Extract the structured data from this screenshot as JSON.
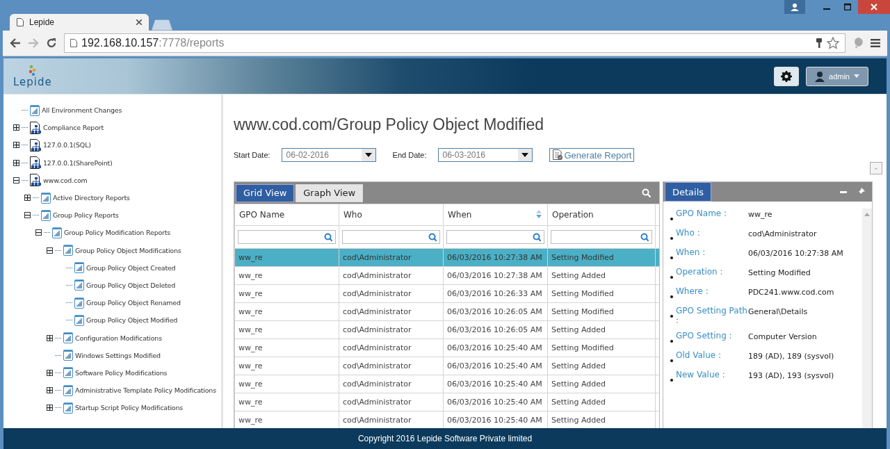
{
  "browser": {
    "tab_title": "Lepide",
    "url_host": "192.168.10.157",
    "url_rest": ":7778/reports"
  },
  "header": {
    "logo_text": "Lepide",
    "user": "admin"
  },
  "tree": [
    {
      "label": "All Environment Changes",
      "kind": "report"
    },
    {
      "label": "Compliance Report",
      "kind": "site",
      "expanded": false
    },
    {
      "label": "127.0.0.1(SQL)",
      "kind": "site",
      "expanded": false
    },
    {
      "label": "127.0.0.1(SharePoint)",
      "kind": "site",
      "expanded": false
    },
    {
      "label": "www.cod.com",
      "kind": "site",
      "expanded": true,
      "children": [
        {
          "label": "Active Directory Reports",
          "kind": "report",
          "expanded": false
        },
        {
          "label": "Group Policy Reports",
          "kind": "report",
          "expanded": true,
          "children": [
            {
              "label": "Group Policy Modification Reports",
              "kind": "report",
              "expanded": true,
              "children": [
                {
                  "label": "Group Policy Object Modifications",
                  "kind": "report",
                  "expanded": true,
                  "children": [
                    {
                      "label": "Group Policy Object Created",
                      "kind": "report"
                    },
                    {
                      "label": "Group Policy Object Deleted",
                      "kind": "report"
                    },
                    {
                      "label": "Group Policy Object Renamed",
                      "kind": "report"
                    },
                    {
                      "label": "Group Policy Object Modified",
                      "kind": "report"
                    }
                  ]
                },
                {
                  "label": "Configuration Modifications",
                  "kind": "report",
                  "expanded": false
                },
                {
                  "label": "Windows Settings Modified",
                  "kind": "report"
                },
                {
                  "label": "Software Policy Modifications",
                  "kind": "report",
                  "expanded": false
                },
                {
                  "label": "Administrative Template Policy Modifications",
                  "kind": "report",
                  "expanded": false
                },
                {
                  "label": "Startup Script Policy Modifications",
                  "kind": "report",
                  "expanded": false
                }
              ]
            }
          ]
        }
      ]
    }
  ],
  "report": {
    "title": "www.cod.com/Group Policy Object Modified",
    "start_label": "Start Date:",
    "start_date": "06-02-2016",
    "end_label": "End Date:",
    "end_date": "06-03-2016",
    "generate": "Generate Report",
    "views": [
      {
        "label": "Grid View",
        "selected": true
      },
      {
        "label": "Graph View",
        "selected": false
      }
    ],
    "columns": [
      {
        "label": "GPO Name",
        "sortable": false
      },
      {
        "label": "Who",
        "sortable": false
      },
      {
        "label": "When",
        "sortable": true
      },
      {
        "label": "Operation",
        "sortable": false
      }
    ],
    "rows": [
      {
        "cells": [
          "ww_re",
          "cod\\Administrator",
          "06/03/2016 10:27:38 AM",
          "Setting Modified"
        ],
        "selected": true
      },
      {
        "cells": [
          "ww_re",
          "cod\\Administrator",
          "06/03/2016 10:27:38 AM",
          "Setting Added"
        ],
        "selected": false
      },
      {
        "cells": [
          "ww_re",
          "cod\\Administrator",
          "06/03/2016 10:26:33 AM",
          "Setting Modified"
        ],
        "selected": false
      },
      {
        "cells": [
          "ww_re",
          "cod\\Administrator",
          "06/03/2016 10:26:05 AM",
          "Setting Modified"
        ],
        "selected": false
      },
      {
        "cells": [
          "ww_re",
          "cod\\Administrator",
          "06/03/2016 10:26:05 AM",
          "Setting Added"
        ],
        "selected": false
      },
      {
        "cells": [
          "ww_re",
          "cod\\Administrator",
          "06/03/2016 10:25:40 AM",
          "Setting Modified"
        ],
        "selected": false
      },
      {
        "cells": [
          "ww_re",
          "cod\\Administrator",
          "06/03/2016 10:25:40 AM",
          "Setting Added"
        ],
        "selected": false
      },
      {
        "cells": [
          "ww_re",
          "cod\\Administrator",
          "06/03/2016 10:25:40 AM",
          "Setting Added"
        ],
        "selected": false
      },
      {
        "cells": [
          "ww_re",
          "cod\\Administrator",
          "06/03/2016 10:25:40 AM",
          "Setting Added"
        ],
        "selected": false
      },
      {
        "cells": [
          "ww_re",
          "cod\\Administrator",
          "06/03/2016 10:25:40 AM",
          "Setting Added"
        ],
        "selected": false
      }
    ]
  },
  "details": {
    "title": "Details",
    "fields": [
      {
        "label": "GPO Name :",
        "value": "ww_re"
      },
      {
        "label": "Who :",
        "value": "cod\\Administrator"
      },
      {
        "label": "When :",
        "value": "06/03/2016 10:27:38 AM"
      },
      {
        "label": "Operation :",
        "value": "Setting Modified"
      },
      {
        "label": "Where :",
        "value": "PDC241.www.cod.com"
      },
      {
        "label": "GPO Setting Path :",
        "value": "General\\Details"
      },
      {
        "label": "GPO Setting :",
        "value": "Computer Version"
      },
      {
        "label": "Old Value :",
        "value": "189 (AD), 189 (sysvol)"
      },
      {
        "label": "New Value :",
        "value": "193 (AD), 193 (sysvol)"
      }
    ]
  },
  "footer": "Copyright 2016 Lepide Software Private limited"
}
